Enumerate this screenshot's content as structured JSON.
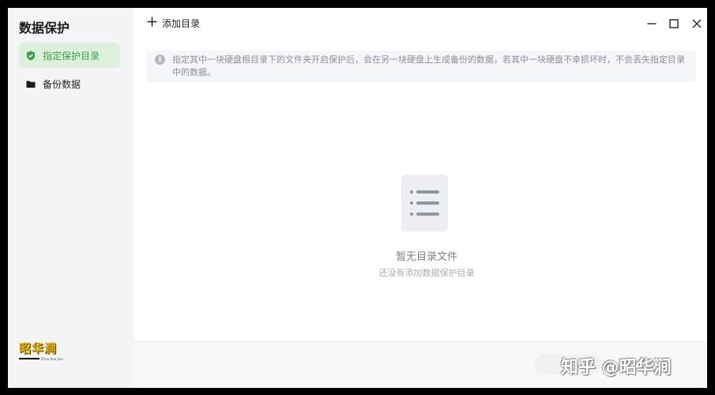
{
  "sidebar": {
    "title": "数据保护",
    "items": [
      {
        "label": "指定保护目录",
        "icon": "shield-icon",
        "active": true
      },
      {
        "label": "备份数据",
        "icon": "folder-icon",
        "active": false
      }
    ],
    "brand": {
      "text": "昭华涧",
      "subtitle": "Zhao Hua Jian"
    }
  },
  "toolbar": {
    "add_label": "添加目录",
    "add_icon": "plus-icon",
    "window_controls": [
      "minimize-icon",
      "maximize-icon",
      "close-icon"
    ]
  },
  "notice": {
    "icon": "info-icon",
    "text": "指定其中一块硬盘根目录下的文件夹开启保护后，会在另一块硬盘上生成备份的数据，若其中一块硬盘不幸损坏时，不会丢失指定目录中的数据。"
  },
  "empty_state": {
    "icon": "list-icon",
    "title": "暂无目录文件",
    "subtitle": "还没有添加数据保护目录"
  },
  "watermark": "知乎 @昭华涧",
  "colors": {
    "accent": "#3aa04a",
    "active_bg": "#dcf0dc",
    "sidebar_bg": "#f3f4f5",
    "notice_bg": "#f5f6f7",
    "brand": "#e5b400"
  }
}
